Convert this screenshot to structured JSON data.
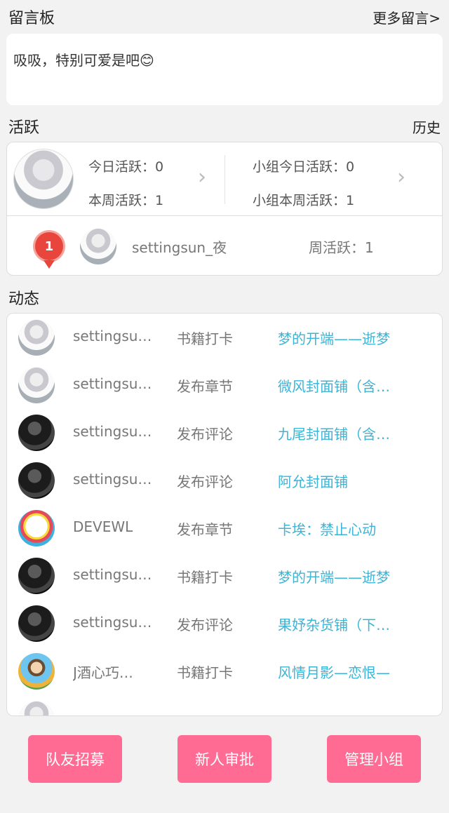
{
  "board": {
    "title": "留言板",
    "more_label": "更多留言>",
    "message": "吸吸，特别可爱是吧😊"
  },
  "activity": {
    "title": "活跃",
    "history_label": "历史",
    "today": "今日活跃：0",
    "week": "本周活跃：1",
    "group_today": "小组今日活跃：0",
    "group_week": "小组本周活跃：1",
    "rank": {
      "position": "1",
      "name": "settingsun_夜",
      "week": "周活跃：1"
    }
  },
  "feed": {
    "title": "动态",
    "items": [
      {
        "user": "settingsu…",
        "action": "书籍打卡",
        "target": "梦的开端——逝梦",
        "avatar": "light"
      },
      {
        "user": "settingsu…",
        "action": "发布章节",
        "target": "微风封面铺（含…",
        "avatar": "light"
      },
      {
        "user": "settingsu…",
        "action": "发布评论",
        "target": "九尾封面铺（含…",
        "avatar": "dark"
      },
      {
        "user": "settingsu…",
        "action": "发布评论",
        "target": "阿允封面铺",
        "avatar": "dark"
      },
      {
        "user": "DEVEWL",
        "action": "发布章节",
        "target": "卡埃：禁止心动",
        "avatar": "cat"
      },
      {
        "user": "settingsu…",
        "action": "书籍打卡",
        "target": "梦的开端——逝梦",
        "avatar": "dark"
      },
      {
        "user": "settingsu…",
        "action": "发布评论",
        "target": "果妤杂货铺（下…",
        "avatar": "dark"
      },
      {
        "user": "J酒心巧…",
        "action": "书籍打卡",
        "target": "风情月影—恋恨—",
        "avatar": "colorful"
      },
      {
        "user": "",
        "action": "",
        "target": "",
        "avatar": "light"
      }
    ]
  },
  "buttons": {
    "recruit": "队友招募",
    "approve": "新人审批",
    "manage": "管理小组"
  },
  "colors": {
    "accent": "#ff6b93",
    "link": "#3cb4d6",
    "medal": "#e8453c"
  }
}
